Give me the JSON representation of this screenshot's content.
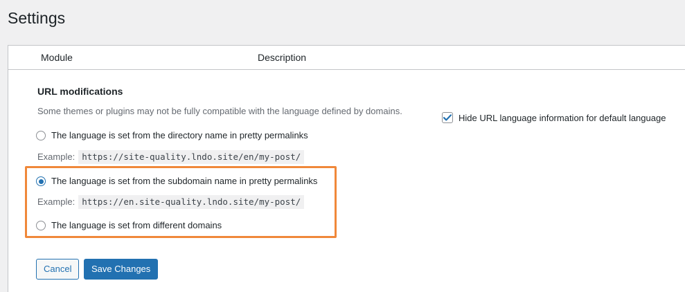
{
  "page": {
    "title": "Settings"
  },
  "table": {
    "columns": [
      "Module",
      "Description"
    ]
  },
  "url_modifications": {
    "title": "URL modifications",
    "description": "Some themes or plugins may not be fully compatible with the language defined by domains.",
    "options": [
      {
        "label": "The language is set from the directory name in pretty permalinks",
        "selected": false,
        "example_label": "Example:",
        "example_url": "https://site-quality.lndo.site/en/my-post/"
      },
      {
        "label": "The language is set from the subdomain name in pretty permalinks",
        "selected": true,
        "example_label": "Example:",
        "example_url": "https://en.site-quality.lndo.site/my-post/"
      },
      {
        "label": "The language is set from different domains",
        "selected": false
      }
    ],
    "hide_default_language": {
      "label": "Hide URL language information for default language",
      "checked": true
    }
  },
  "actions": {
    "cancel_label": "Cancel",
    "save_label": "Save Changes"
  },
  "colors": {
    "accent": "#2271b1",
    "highlight": "#f0883a"
  }
}
